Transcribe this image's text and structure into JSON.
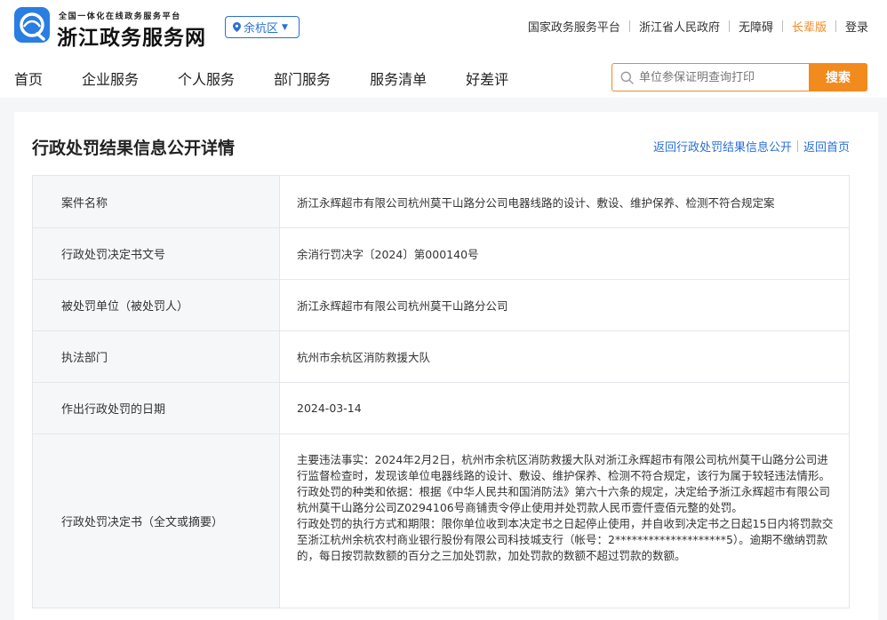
{
  "header": {
    "brand_sub": "全国一体化在线政务服务平台",
    "brand_name": "浙江政务服务网",
    "region": "余杭区",
    "top_links": [
      "国家政务服务平台",
      "浙江省人民政府",
      "无障碍",
      "长辈版",
      "登录"
    ],
    "accent_color": "#f08a24"
  },
  "nav": [
    "首页",
    "企业服务",
    "个人服务",
    "部门服务",
    "服务清单",
    "好差评"
  ],
  "search": {
    "placeholder": "单位参保证明查询打印",
    "button": "搜索"
  },
  "page": {
    "title": "行政处罚结果信息公开详情",
    "link_back_list": "返回行政处罚结果信息公开",
    "link_home": "返回首页"
  },
  "details": [
    {
      "label": "案件名称",
      "value": "浙江永辉超市有限公司杭州莫干山路分公司电器线路的设计、敷设、维护保养、检测不符合规定案"
    },
    {
      "label": "行政处罚决定书文号",
      "value": "余消行罚决字〔2024〕第000140号"
    },
    {
      "label": "被处罚单位（被处罚人）",
      "value": "浙江永辉超市有限公司杭州莫干山路分公司"
    },
    {
      "label": "执法部门",
      "value": "杭州市余杭区消防救援大队"
    },
    {
      "label": "作出行政处罚的日期",
      "value": "2024-03-14"
    }
  ],
  "decision": {
    "label": "行政处罚决定书（全文或摘要）",
    "para1": "主要违法事实：2024年2月2日，杭州市余杭区消防救援大队对浙江永辉超市有限公司杭州莫干山路分公司进行监督检查时，发现该单位电器线路的设计、敷设、维护保养、检测不符合规定，该行为属于较轻违法情形。",
    "para2": "行政处罚的种类和依据：根据《中华人民共和国消防法》第六十六条的规定，决定给予浙江永辉超市有限公司杭州莫干山路分公司Z0294106号商铺责令停止使用并处罚款人民币壹仟壹佰元整的处罚。",
    "para3": "行政处罚的执行方式和期限：限你单位收到本决定书之日起停止使用，并自收到决定书之日起15日内将罚款交至浙江杭州余杭农村商业银行股份有限公司科技城支行（帐号：2********************5）。逾期不缴纳罚款的，每日按罚款数额的百分之三加处罚款，加处罚款的数额不超过罚款的数额。"
  }
}
